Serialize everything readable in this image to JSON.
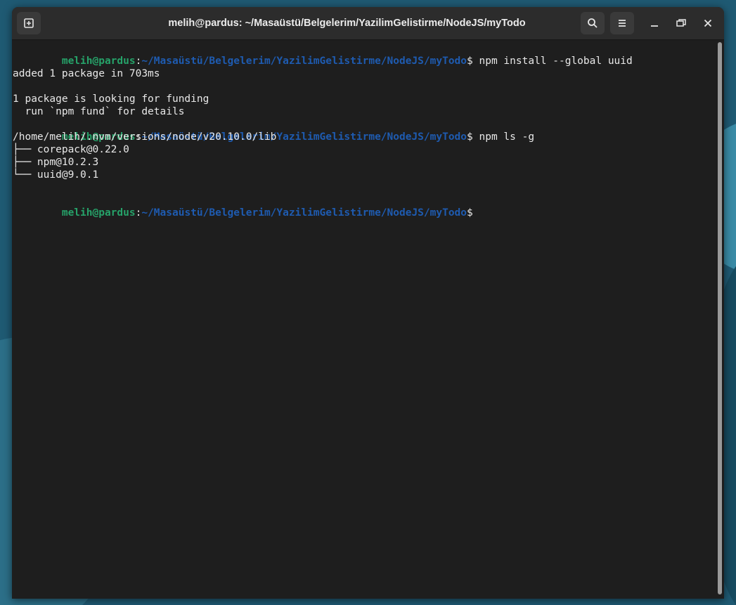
{
  "window": {
    "title": "melih@pardus: ~/Masaüstü/Belgelerim/YazilimGelistirme/NodeJS/myTodo"
  },
  "headerbar": {
    "new_tab_icon": "new-tab-icon",
    "search_icon": "search-icon",
    "menu_icon": "hamburger-menu-icon",
    "minimize_icon": "minimize-icon",
    "maximize_icon": "restore-icon",
    "close_icon": "close-icon"
  },
  "terminal": {
    "prompt_user": "melih@pardus",
    "prompt_sep": ":",
    "prompt_path": "~/Masaüstü/Belgelerim/YazilimGelistirme/NodeJS/myTodo",
    "prompt_end": "$",
    "cmd1": " npm install --global uuid",
    "out1": "added 1 package in 703ms",
    "out2": "1 package is looking for funding",
    "out3": "  run `npm fund` for details",
    "cmd2": " npm ls -g",
    "out4": "/home/melih/.nvm/versions/node/v20.10.0/lib",
    "tree": [
      "├── corepack@0.22.0",
      "├── npm@10.2.3",
      "└── uuid@9.0.1"
    ]
  },
  "colors": {
    "user": "#26a269",
    "path": "#1e5bb0",
    "background": "#1e1e1e"
  }
}
